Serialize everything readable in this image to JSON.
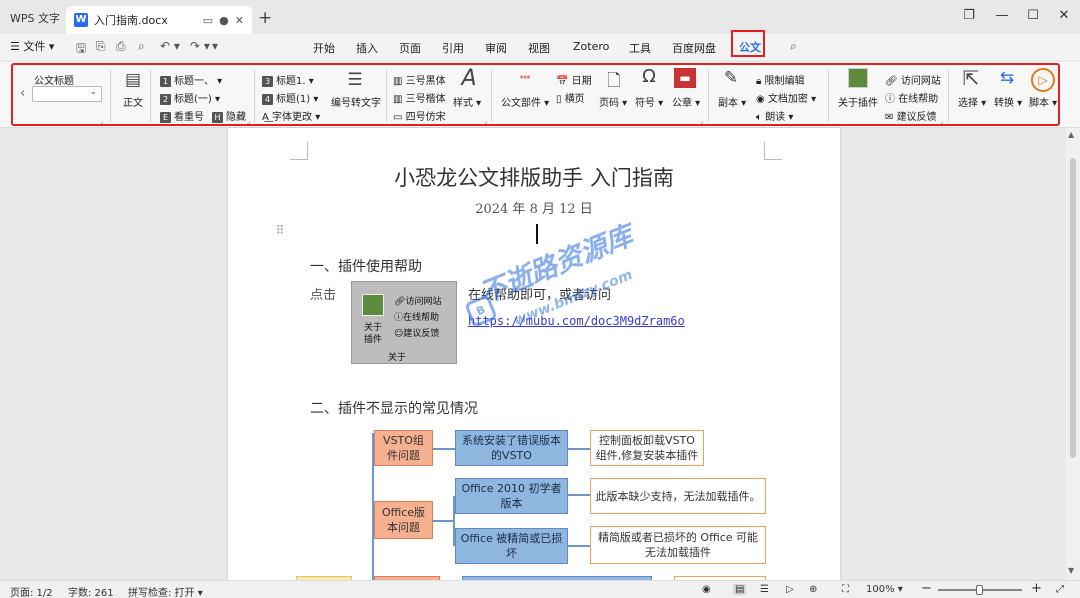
{
  "titlebar": {
    "app_tab": "WPS 文字",
    "doc_tab": "入门指南.docx",
    "doc_badge": "W",
    "new_tab": "+"
  },
  "menu": {
    "file": "文件",
    "items": [
      "开始",
      "插入",
      "页面",
      "引用",
      "审阅",
      "视图",
      "Zotero",
      "工具",
      "百度网盘",
      "公文"
    ],
    "active": "公文"
  },
  "ribbon": {
    "style_combo_label": "公文标题",
    "zhengwen": "正文",
    "heading_one": "标题一、",
    "heading_two": "标题(一)",
    "heading_num3": "标题1.",
    "heading_num4": "标题(1)",
    "kanzhonghao": "看重号",
    "yincang": "隐藏",
    "font_change": "字体更改",
    "number_to_text": "编号转文字",
    "font_black": "三号黑体",
    "font_kai": "三号楷体",
    "font_fangsong": "四号仿宋",
    "style": "样式",
    "doc_parts": "公文部件",
    "date": "日期",
    "landscape": "横页",
    "page_number": "页码",
    "symbol": "符号",
    "seal": "公章",
    "copy": "副本",
    "restrict_edit": "限制编辑",
    "doc_encrypt": "文档加密",
    "read_aloud": "朗读",
    "about_plugin": "关于插件",
    "visit_site": "访问网站",
    "online_help": "在线帮助",
    "feedback": "建议反馈",
    "select": "选择",
    "convert": "转换",
    "script": "脚本"
  },
  "document": {
    "title": "小恐龙公文排版助手 入门指南",
    "date": "2024 年 8 月 12 日",
    "section1": "一、插件使用帮助",
    "para1_prefix": "点击",
    "para1_suffix": "在线帮助即可，或者访问",
    "link": "https://mubu.com/doc3M9dZram6o",
    "panel": {
      "about_line1": "关于",
      "about_line2": "插件",
      "visit": "访问网站",
      "help": "在线帮助",
      "feedback": "建议反馈",
      "group": "关于"
    },
    "section2": "二、插件不显示的常见情况",
    "flow": {
      "vsto_problem": "VSTO组件问题",
      "vsto_cause": "系统安装了错误版本的VSTO",
      "vsto_fix": "控制面板卸载VSTO组件,修复安装本插件",
      "office_problem": "Office版本问题",
      "office_cause1": "Office 2010 初学者版本",
      "office_fix1": "此版本缺少支持，无法加载插件。",
      "office_cause2": "Office 被精简或已损坏",
      "office_fix2": "精简版或者已损坏的 Office 可能无法加载插件"
    },
    "watermark": "不逝路资源库",
    "watermark_url": "www.bmlzy.com"
  },
  "statusbar": {
    "page": "页面: 1/2",
    "words": "字数: 261",
    "spell": "拼写检查: 打开",
    "zoom": "100%",
    "minus": "−",
    "plus": "+"
  }
}
